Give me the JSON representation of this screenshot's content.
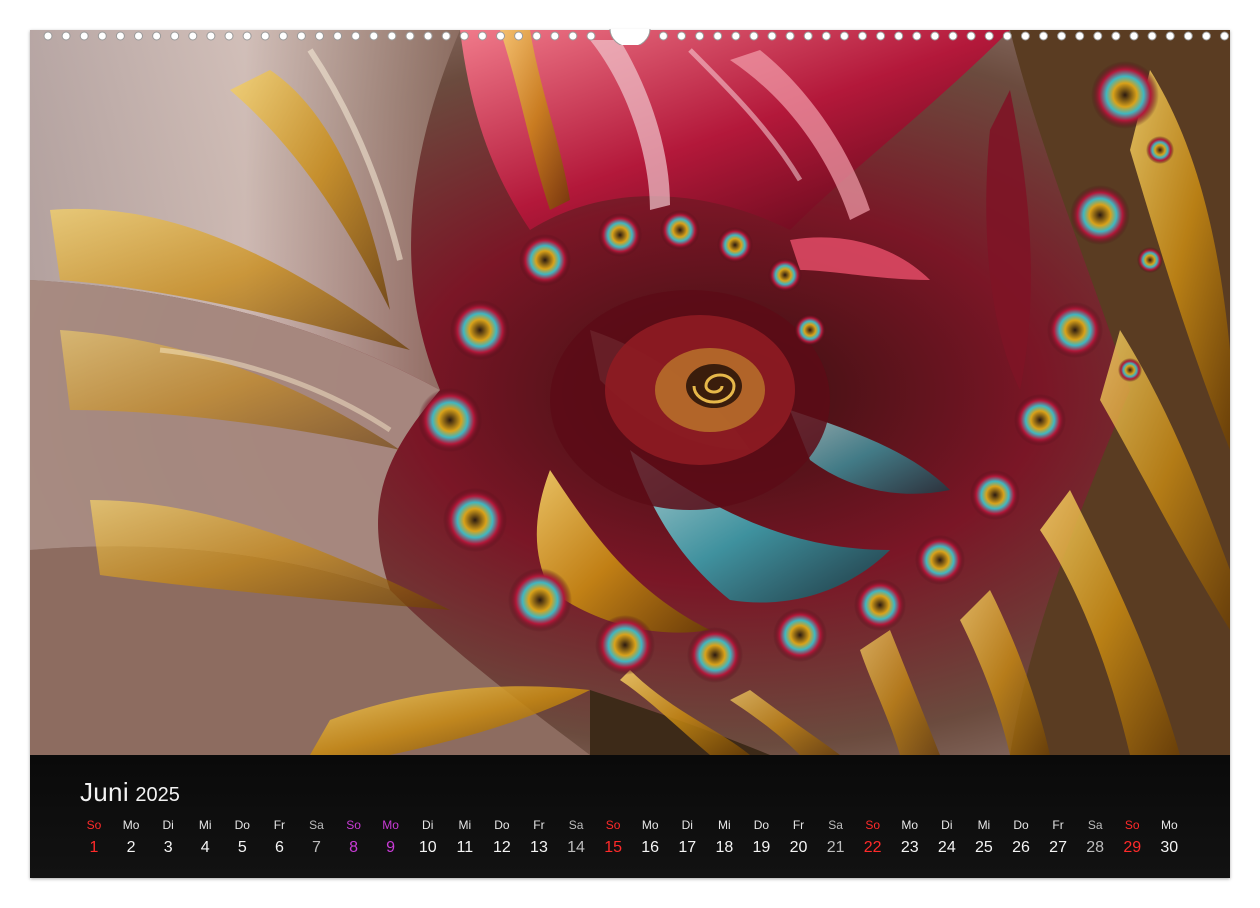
{
  "calendar": {
    "month": "Juni",
    "year": "2025",
    "weekday_labels": [
      "So",
      "Mo",
      "Di",
      "Mi",
      "Do",
      "Fr",
      "Sa",
      "So",
      "Mo",
      "Di",
      "Mi",
      "Do",
      "Fr",
      "Sa",
      "So",
      "Mo",
      "Di",
      "Mi",
      "Do",
      "Fr",
      "Sa",
      "So",
      "Mo",
      "Di",
      "Mi",
      "Do",
      "Fr",
      "Sa",
      "So",
      "Mo"
    ],
    "day_numbers": [
      "1",
      "2",
      "3",
      "4",
      "5",
      "6",
      "7",
      "8",
      "9",
      "10",
      "11",
      "12",
      "13",
      "14",
      "15",
      "16",
      "17",
      "18",
      "19",
      "20",
      "21",
      "22",
      "23",
      "24",
      "25",
      "26",
      "27",
      "28",
      "29",
      "30"
    ],
    "day_types": [
      "sun",
      "",
      "",
      "",
      "",
      "",
      "sat",
      "hol",
      "hol",
      "",
      "",
      "",
      "",
      "sat",
      "sun",
      "",
      "",
      "",
      "",
      "",
      "sat",
      "sun",
      "",
      "",
      "",
      "",
      "",
      "sat",
      "sun",
      ""
    ]
  },
  "artwork": {
    "subject": "fractal spiral",
    "colors": {
      "crimson": "#9e1a32",
      "gold": "#d9a21a",
      "teal": "#3fb7c1",
      "silver": "#c9bfc2",
      "bronze": "#8a5a3a"
    }
  },
  "binding": {
    "type": "spiral-wire-dots"
  }
}
